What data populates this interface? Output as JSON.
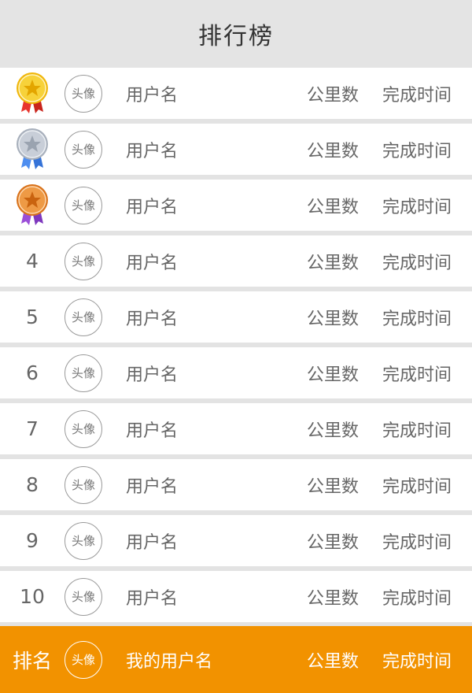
{
  "header": {
    "title": "排行榜"
  },
  "colors": {
    "accent": "#f29200",
    "gold": "#f5c518",
    "silver": "#b8bec8",
    "bronze": "#e07b24",
    "gold_ribbon": "#e8342c",
    "silver_ribbon": "#4e8ef0",
    "bronze_ribbon": "#9b4fd8"
  },
  "rows": [
    {
      "rank": "1",
      "medal": "gold-medal-icon",
      "avatar": "头像",
      "username": "用户名",
      "distance": "公里数",
      "time": "完成时间"
    },
    {
      "rank": "2",
      "medal": "silver-medal-icon",
      "avatar": "头像",
      "username": "用户名",
      "distance": "公里数",
      "time": "完成时间"
    },
    {
      "rank": "3",
      "medal": "bronze-medal-icon",
      "avatar": "头像",
      "username": "用户名",
      "distance": "公里数",
      "time": "完成时间"
    },
    {
      "rank": "4",
      "avatar": "头像",
      "username": "用户名",
      "distance": "公里数",
      "time": "完成时间"
    },
    {
      "rank": "5",
      "avatar": "头像",
      "username": "用户名",
      "distance": "公里数",
      "time": "完成时间"
    },
    {
      "rank": "6",
      "avatar": "头像",
      "username": "用户名",
      "distance": "公里数",
      "time": "完成时间"
    },
    {
      "rank": "7",
      "avatar": "头像",
      "username": "用户名",
      "distance": "公里数",
      "time": "完成时间"
    },
    {
      "rank": "8",
      "avatar": "头像",
      "username": "用户名",
      "distance": "公里数",
      "time": "完成时间"
    },
    {
      "rank": "9",
      "avatar": "头像",
      "username": "用户名",
      "distance": "公里数",
      "time": "完成时间"
    },
    {
      "rank": "10",
      "avatar": "头像",
      "username": "用户名",
      "distance": "公里数",
      "time": "完成时间"
    }
  ],
  "my_row": {
    "rank": "排名",
    "avatar": "头像",
    "username": "我的用户名",
    "distance": "公里数",
    "time": "完成时间"
  }
}
